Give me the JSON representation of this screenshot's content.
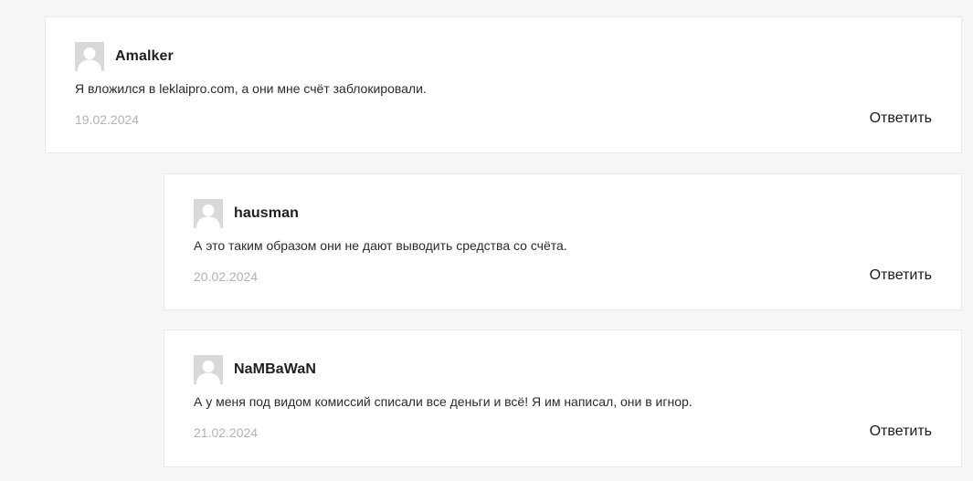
{
  "comments": [
    {
      "author": "Amalker",
      "text": "Я вложился в leklaipro.com, а они мне счёт заблокировали.",
      "date": "19.02.2024",
      "reply_label": "Ответить",
      "avatar_icon": "default-user-avatar-icon"
    },
    {
      "author": "hausman",
      "text": "А это таким образом они не дают выводить средства со счёта.",
      "date": "20.02.2024",
      "reply_label": "Ответить",
      "avatar_icon": "default-user-avatar-icon"
    },
    {
      "author": "NaMBaWaN",
      "text": "А у меня под видом комиссий списали все деньги и всё! Я им написал, они в игнор.",
      "date": "21.02.2024",
      "reply_label": "Ответить",
      "avatar_icon": "default-user-avatar-icon"
    }
  ],
  "colors": {
    "background": "#f6f6f4",
    "card": "#ffffff",
    "date": "#b3b3b3",
    "avatar": "#d9d9d9"
  }
}
